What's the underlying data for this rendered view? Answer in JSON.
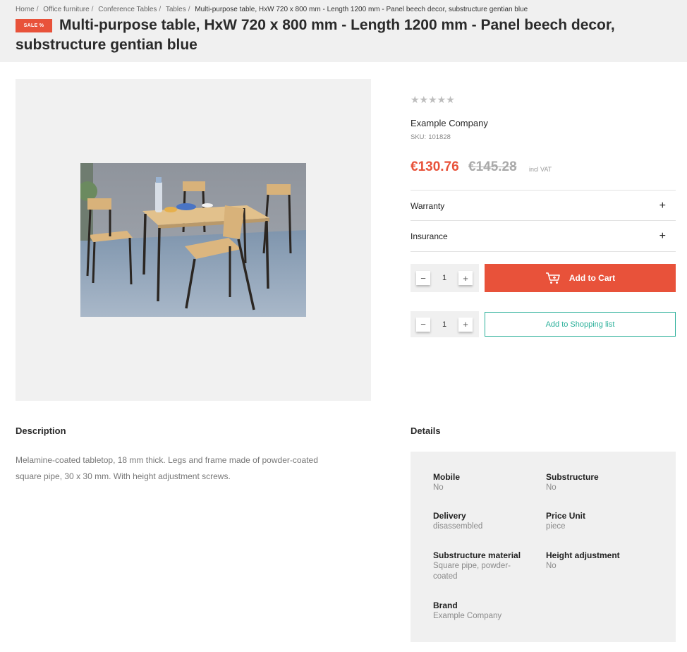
{
  "breadcrumb": [
    {
      "label": "Home"
    },
    {
      "label": "Office furniture"
    },
    {
      "label": "Conference Tables"
    },
    {
      "label": "Tables"
    }
  ],
  "breadcrumb_current": "Multi-purpose table, HxW 720 x 800 mm - Length 1200 mm - Panel beech decor, substructure gentian blue",
  "sale_badge": "SALE %",
  "title": "Multi-purpose table, HxW 720 x 800 mm - Length 1200 mm - Panel beech decor, substructure gentian blue",
  "product": {
    "rating_stars": "★★★★★",
    "rating_value": 0,
    "company": "Example Company",
    "sku_label": "SKU:",
    "sku_value": "101828",
    "price_sale": "€130.76",
    "price_old": "€145.28",
    "vat_note": "incl VAT"
  },
  "accordions": [
    {
      "label": "Warranty",
      "icon": "plus-icon"
    },
    {
      "label": "Insurance",
      "icon": "plus-icon"
    }
  ],
  "cart": {
    "qty": "1",
    "minus": "−",
    "plus": "+",
    "add_to_cart_label": "Add to Cart",
    "add_to_list_label": "Add to Shopping list"
  },
  "description": {
    "title": "Description",
    "text": "Melamine-coated tabletop, 18 mm thick. Legs and frame made of powder-coated square pipe, 30 x 30 mm. With height adjustment screws."
  },
  "details": {
    "title": "Details",
    "items": [
      {
        "label": "Mobile",
        "value": "No"
      },
      {
        "label": "Substructure",
        "value": "No"
      },
      {
        "label": "Delivery",
        "value": "disassembled"
      },
      {
        "label": "Price Unit",
        "value": "piece"
      },
      {
        "label": "Substructure material",
        "value": "Square pipe, powder-coated"
      },
      {
        "label": "Height adjustment",
        "value": "No"
      },
      {
        "label": "Brand",
        "value": "Example Company"
      }
    ]
  },
  "colors": {
    "accent": "#e8523a",
    "secondary": "#2bb09a",
    "header_bg": "#f0f0f0"
  }
}
